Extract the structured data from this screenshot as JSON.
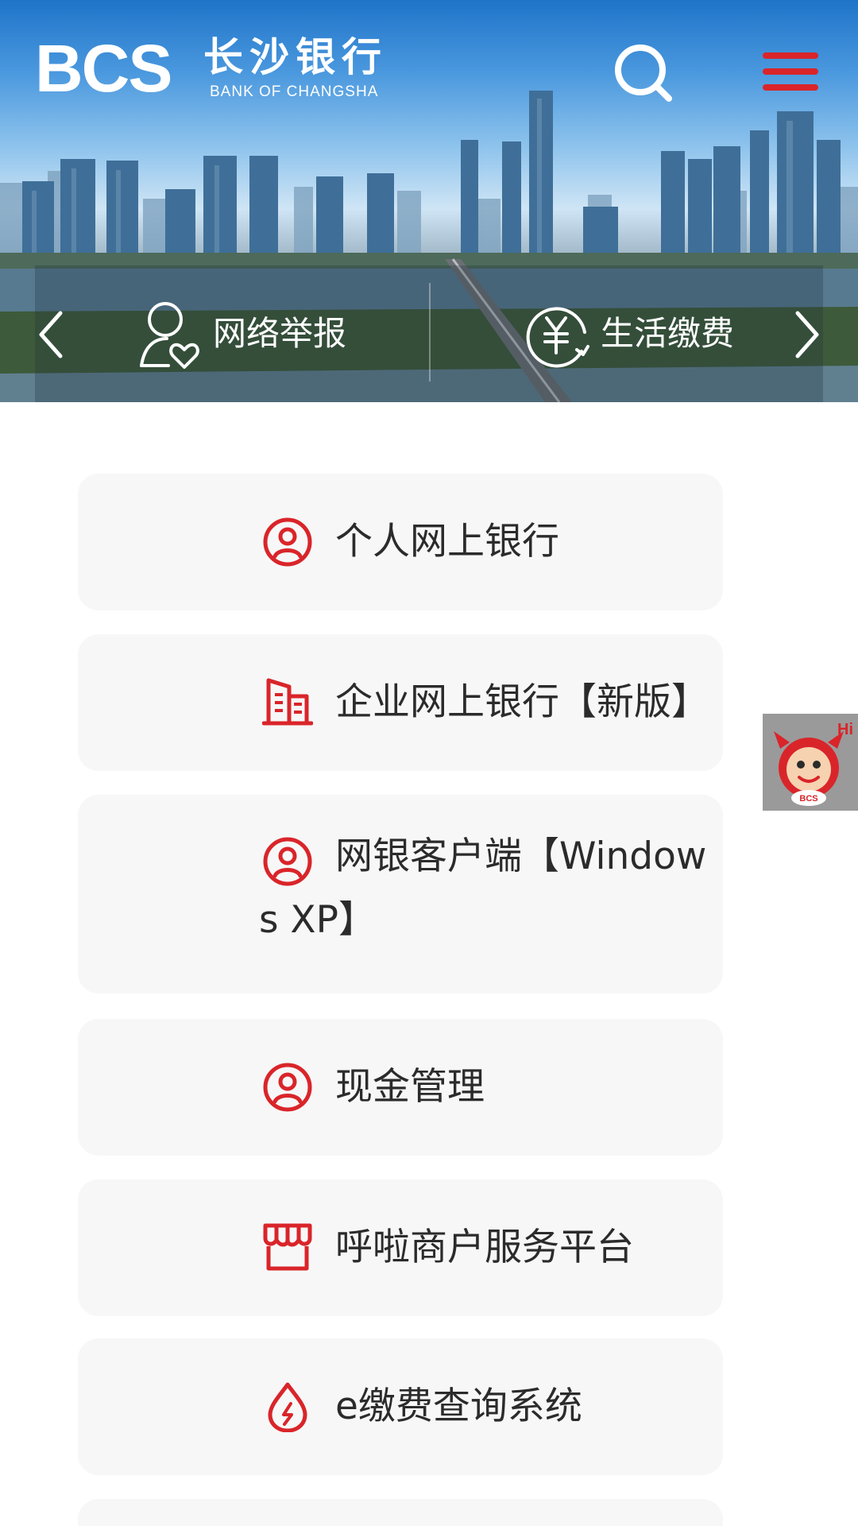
{
  "brand": {
    "logo_mark": "BCS",
    "name_cn": "长沙银行",
    "name_en": "BANK OF CHANGSHA",
    "primary_color": "#d9252a"
  },
  "header": {
    "search_icon": "search-icon",
    "menu_icon": "hamburger-menu-icon"
  },
  "quick_links": [
    {
      "label": "网络举报",
      "icon": "user-heart-report-icon"
    },
    {
      "label": "生活缴费",
      "icon": "yuan-payment-icon"
    }
  ],
  "carousel": {
    "prev_icon": "chevron-left-icon",
    "next_icon": "chevron-right-icon"
  },
  "menu_cards": [
    {
      "label": "个人网上银行",
      "icon": "person-circle-icon"
    },
    {
      "label": "企业网上银行【新版】",
      "icon": "building-icon"
    },
    {
      "label": "网银客户端【Windows XP】",
      "icon": "person-circle-icon"
    },
    {
      "label": "现金管理",
      "icon": "person-circle-icon"
    },
    {
      "label": "呼啦商户服务平台",
      "icon": "storefront-icon"
    },
    {
      "label": "e缴费查询系统",
      "icon": "drop-lightning-icon"
    }
  ],
  "mascot": {
    "greeting": "Hi",
    "badge": "BCS",
    "icon": "mascot-icon"
  }
}
